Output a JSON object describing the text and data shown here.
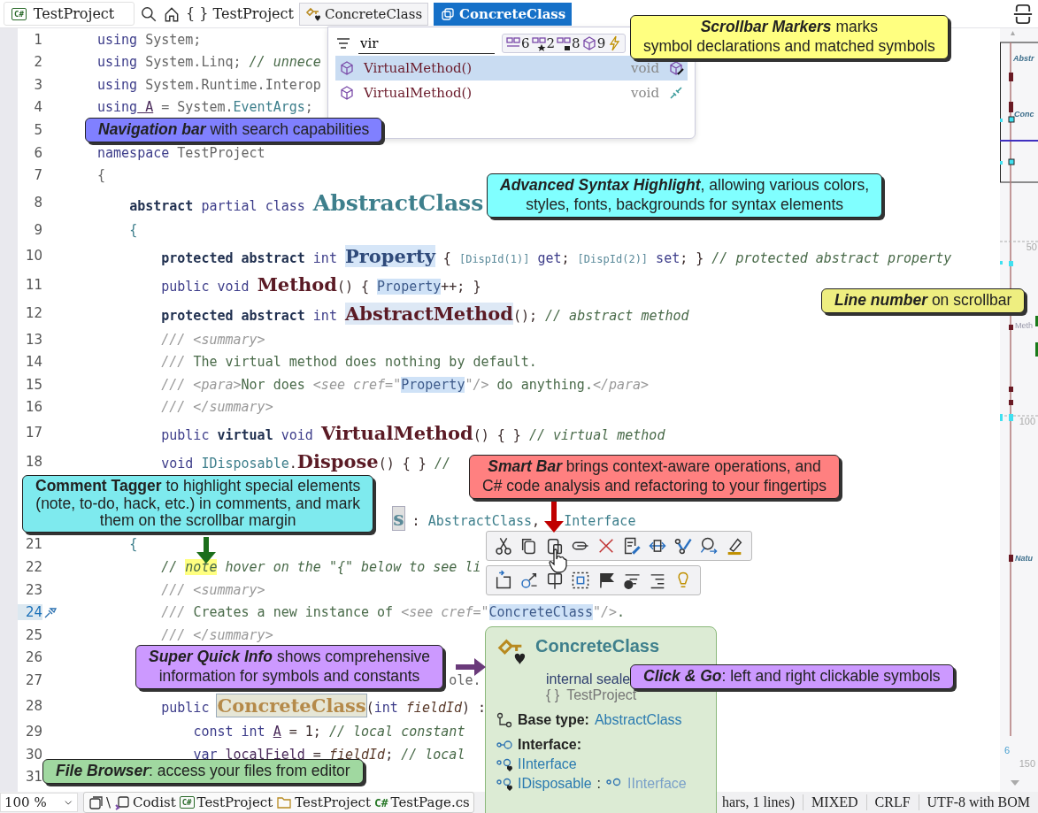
{
  "top_bar": {
    "project_selector": {
      "badge": "C#",
      "label": "TestProject"
    },
    "namespace": {
      "glyph": "{ }",
      "label": "TestProject"
    },
    "tabs": [
      {
        "label": "ConcreteClass",
        "kind": "symbol",
        "selected": false
      },
      {
        "label": "ConcreteClass",
        "kind": "class",
        "selected": true
      }
    ]
  },
  "search_popup": {
    "value": "vir",
    "filters": [
      {
        "kind": "class",
        "count": "6"
      },
      {
        "kind": "starred",
        "count": "2"
      },
      {
        "kind": "locked",
        "count": "8"
      },
      {
        "kind": "member",
        "count": "9"
      }
    ],
    "results": [
      {
        "name": "VirtualMethod()",
        "type": "void",
        "kind": "edit",
        "selected": true
      },
      {
        "name": "VirtualMethod()",
        "type": "void",
        "kind": "link",
        "selected": false
      }
    ]
  },
  "code_lines": [
    {
      "number": "1",
      "current": false,
      "tokens": [
        {
          "kind": "kw",
          "text": "using"
        },
        {
          "kind": "plain",
          "text": " System;"
        }
      ]
    },
    {
      "number": "2",
      "current": false,
      "tokens": [
        {
          "kind": "kw",
          "text": "using"
        },
        {
          "kind": "plain",
          "text": " System.Linq; "
        },
        {
          "kind": "comment",
          "text": "// unnece"
        }
      ]
    },
    {
      "number": "3",
      "current": false,
      "tokens": [
        {
          "kind": "kw",
          "text": "using"
        },
        {
          "kind": "plain",
          "text": " System.Runtime.Interop"
        }
      ]
    },
    {
      "number": "4",
      "current": false,
      "tokens": [
        {
          "kind": "kw",
          "text": "using"
        },
        {
          "kind": "local",
          "text": " A"
        },
        {
          "kind": "plain",
          "text": " = System."
        },
        {
          "kind": "type",
          "text": "EventArgs"
        },
        {
          "kind": "plain",
          "text": ";"
        }
      ]
    },
    {
      "number": "5",
      "current": false
    },
    {
      "number": "6",
      "current": false,
      "tokens": [
        {
          "kind": "kw",
          "text": "namespace"
        },
        {
          "kind": "plain",
          "text": " TestProject"
        }
      ]
    },
    {
      "number": "7",
      "current": false,
      "tokens": [
        {
          "kind": "plain",
          "text": "{"
        }
      ]
    },
    {
      "number": "8",
      "current": false,
      "tokens": [
        {
          "kind": "kwb",
          "text": "    abstract"
        },
        {
          "kind": "kw",
          "text": " partial class "
        },
        {
          "kind": "classname",
          "text": "AbstractClass"
        }
      ]
    },
    {
      "number": "9",
      "current": false,
      "tokens": [
        {
          "kind": "brace",
          "text": "    {"
        }
      ]
    },
    {
      "number": "10",
      "current": false,
      "tokens": [
        {
          "kind": "kwb",
          "text": "        protected abstract"
        },
        {
          "kind": "kw",
          "text": " int "
        },
        {
          "kind": "prop",
          "text": "Property"
        },
        {
          "kind": "punct",
          "text": " { "
        },
        {
          "kind": "attr",
          "text": "[DispId(1)]"
        },
        {
          "kind": "kw",
          "text": " get"
        },
        {
          "kind": "punct",
          "text": "; "
        },
        {
          "kind": "attr",
          "text": "[DispId(2)]"
        },
        {
          "kind": "kw",
          "text": " set"
        },
        {
          "kind": "punct",
          "text": "; } "
        },
        {
          "kind": "comment",
          "text": "// protected abstract property"
        }
      ]
    },
    {
      "number": "11",
      "current": false,
      "tokens": [
        {
          "kind": "kw",
          "text": "        public void "
        },
        {
          "kind": "method",
          "text": "Method"
        },
        {
          "kind": "punct",
          "text": "() { "
        },
        {
          "kind": "ref",
          "text": "Property"
        },
        {
          "kind": "punct",
          "text": "++; }"
        }
      ]
    },
    {
      "number": "12",
      "current": false,
      "tokens": [
        {
          "kind": "kwb",
          "text": "        protected abstract"
        },
        {
          "kind": "kw",
          "text": " int "
        },
        {
          "kind": "methodref",
          "text": "AbstractMethod"
        },
        {
          "kind": "punct",
          "text": "(); "
        },
        {
          "kind": "comment",
          "text": "// abstract method"
        }
      ]
    },
    {
      "number": "13",
      "current": false,
      "tokens": [
        {
          "kind": "doc",
          "text": "        /// <summary>"
        }
      ]
    },
    {
      "number": "14",
      "current": false,
      "tokens": [
        {
          "kind": "doc",
          "text": "        /// "
        },
        {
          "kind": "doctext",
          "text": "The virtual method does nothing by default."
        }
      ]
    },
    {
      "number": "15",
      "current": false,
      "tokens": [
        {
          "kind": "doc",
          "text": "        /// <para>"
        },
        {
          "kind": "doctext",
          "text": "Nor does "
        },
        {
          "kind": "doc",
          "text": "<see cref=\""
        },
        {
          "kind": "ref",
          "text": "Property"
        },
        {
          "kind": "doc",
          "text": "\"/>"
        },
        {
          "kind": "doctext",
          "text": " do anything."
        },
        {
          "kind": "doc",
          "text": "</para>"
        }
      ]
    },
    {
      "number": "16",
      "current": false,
      "tokens": [
        {
          "kind": "doc",
          "text": "        /// </summary>"
        }
      ]
    },
    {
      "number": "17",
      "current": false,
      "tokens": [
        {
          "kind": "kw",
          "text": "        public "
        },
        {
          "kind": "kwb",
          "text": "virtual"
        },
        {
          "kind": "kw",
          "text": " void "
        },
        {
          "kind": "method",
          "text": "VirtualMethod"
        },
        {
          "kind": "punct",
          "text": "() { } "
        },
        {
          "kind": "comment",
          "text": "// virtual method"
        }
      ]
    },
    {
      "number": "18",
      "current": false,
      "tokens": [
        {
          "kind": "kw",
          "text": "        void "
        },
        {
          "kind": "type",
          "text": "IDisposable"
        },
        {
          "kind": "punct",
          "text": "."
        },
        {
          "kind": "method",
          "text": "Dispose"
        },
        {
          "kind": "punct",
          "text": "() { } "
        },
        {
          "kind": "comment",
          "text": "//"
        }
      ]
    },
    {
      "kind": "covered"
    },
    {
      "kind": "covered",
      "tokens": [
        {
          "kind": "classdecl",
          "text": "                                     s"
        },
        {
          "kind": "punct",
          "text": " : "
        },
        {
          "kind": "type",
          "text": "AbstractClass"
        },
        {
          "kind": "punct",
          "text": ",   "
        },
        {
          "kind": "type",
          "text": "Interface"
        }
      ]
    },
    {
      "number": "21",
      "current": false,
      "tokens": [
        {
          "kind": "brace",
          "text": "    {"
        }
      ]
    },
    {
      "number": "22",
      "current": false,
      "tokens": [
        {
          "kind": "comment",
          "text": "        // "
        },
        {
          "kind": "note",
          "text": "note"
        },
        {
          "kind": "comment",
          "text": " hover on the \"{\" below to see li"
        }
      ]
    },
    {
      "number": "23",
      "current": false,
      "tokens": [
        {
          "kind": "doc",
          "text": "        /// <summary>"
        }
      ]
    },
    {
      "number": "24",
      "current": true,
      "tokens": [
        {
          "kind": "doc",
          "text": "        /// "
        },
        {
          "kind": "doctext",
          "text": "Creates a new instance of "
        },
        {
          "kind": "doc",
          "text": "<see cref=\""
        },
        {
          "kind": "ref",
          "text": "ConcreteClass"
        },
        {
          "kind": "doc",
          "text": "\"/>"
        },
        {
          "kind": "doctext",
          "text": "."
        }
      ]
    },
    {
      "number": "25",
      "current": false,
      "tokens": [
        {
          "kind": "doc",
          "text": "        /// </summary>"
        }
      ]
    },
    {
      "number": "26",
      "current": false
    },
    {
      "number": "27",
      "current": false,
      "tokens": [
        {
          "kind": "plain",
          "text": "                                            ole."
        }
      ]
    },
    {
      "number": "28",
      "current": false,
      "tokens": [
        {
          "kind": "kw",
          "text": "        public "
        },
        {
          "kind": "ctor",
          "text": "ConcreteClass"
        },
        {
          "kind": "punct",
          "text": "("
        },
        {
          "kind": "kw",
          "text": "int "
        },
        {
          "kind": "param",
          "text": "fieldId"
        },
        {
          "kind": "punct",
          "text": ") :"
        }
      ]
    },
    {
      "number": "29",
      "current": false,
      "tokens": [
        {
          "kind": "kw",
          "text": "            const int "
        },
        {
          "kind": "local",
          "text": "A"
        },
        {
          "kind": "punct",
          "text": " = 1; "
        },
        {
          "kind": "comment",
          "text": "// local constant"
        }
      ]
    },
    {
      "number": "30",
      "current": false,
      "tokens": [
        {
          "kind": "kw",
          "text": "            var "
        },
        {
          "kind": "local",
          "text": "localField"
        },
        {
          "kind": "punct",
          "text": " = "
        },
        {
          "kind": "param",
          "text": "fieldId"
        },
        {
          "kind": "punct",
          "text": "; "
        },
        {
          "kind": "comment",
          "text": "// local"
        }
      ]
    },
    {
      "number": "31",
      "current": false
    }
  ],
  "scrollbar": {
    "labels": [
      "Abstr",
      "Conc",
      "50",
      "Meth",
      "100",
      "Natu",
      "6",
      "150"
    ]
  },
  "quick_info": {
    "title": "ConcreteClass",
    "modifiers": "internal seale",
    "namespace_glyph": "{ }",
    "namespace": "TestProject",
    "base_label": "Base type:",
    "base_value": "AbstractClass",
    "interface_label": "Interface:",
    "interfaces": [
      {
        "name": "IInterface"
      },
      {
        "name": "IDisposable",
        "separator": ":",
        "inherits": "IInterface"
      }
    ]
  },
  "status_bar": {
    "zoom": "100 %",
    "path": [
      {
        "kind": "root",
        "label": "\\"
      },
      {
        "kind": "solution",
        "label": "Codist"
      },
      {
        "kind": "project",
        "badge": "C#",
        "label": "TestProject"
      },
      {
        "kind": "folder",
        "label": "TestProject"
      },
      {
        "kind": "file",
        "badge": "C#",
        "label": "TestPage.cs"
      }
    ],
    "fields": [
      "hars, 1 lines)",
      "MIXED",
      "CRLF",
      "UTF-8 with BOM"
    ]
  },
  "callouts": [
    {
      "lines": [
        "**Scrollbar Markers** marks",
        "symbol declarations and matched symbols"
      ],
      "title_italic": true,
      "color": "#ffff80"
    },
    {
      "lines": [
        "**Navigation bar** with search capabilities"
      ],
      "title_italic": true,
      "color": "#8080ff"
    },
    {
      "lines": [
        "**Advanced Syntax Highlight**, allowing various colors,",
        "styles, fonts, backgrounds for syntax elements"
      ],
      "title_italic": true,
      "color": "#80ffff"
    },
    {
      "lines": [
        "**Line number** on scrollbar"
      ],
      "title_italic": true,
      "color": "#eeee80"
    },
    {
      "lines": [
        "**Smart Bar** brings context-aware operations, and",
        "C# code analysis and refactoring to your fingertips"
      ],
      "title_italic": true,
      "color": "#ff8080",
      "arrow": {
        "kind": "down",
        "color": "#c00000"
      }
    },
    {
      "lines": [
        "**Comment Tagger** to highlight special elements",
        "(note, to-do, hack, etc.) in comments, and mark",
        "them on the scrollbar margin"
      ],
      "title_italic": false,
      "color": "#7eeaee",
      "arrow": {
        "kind": "down",
        "color": "#1b6e1b"
      }
    },
    {
      "lines": [
        "**Super Quick Info** shows comprehensive",
        "information for symbols and constants"
      ],
      "title_italic": true,
      "color": "#cc99ff",
      "arrow": {
        "kind": "right",
        "color": "#6a3a7a"
      }
    },
    {
      "lines": [
        "**Click & Go**: left and right clickable symbols"
      ],
      "title_italic": true,
      "color": "#cc99ff"
    },
    {
      "lines": [
        "**File Browser**: access your files from editor"
      ],
      "title_italic": true,
      "color": "#a0d8a0"
    }
  ]
}
